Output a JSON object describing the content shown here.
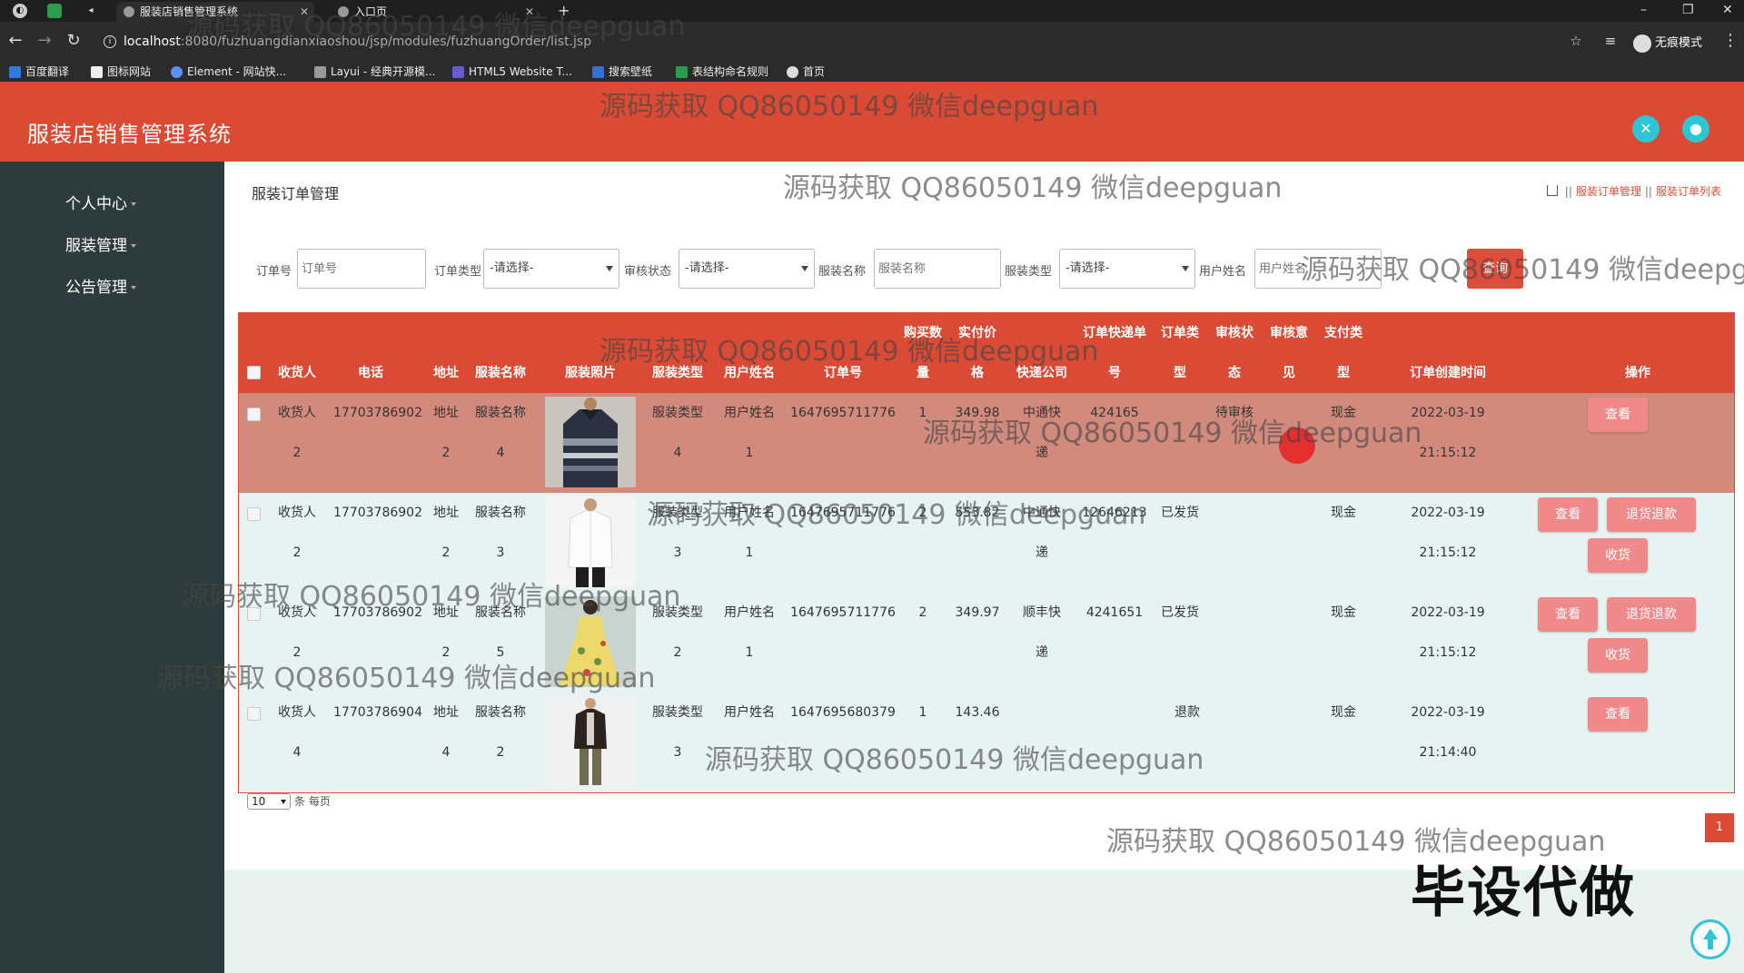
{
  "browser": {
    "tabs": [
      {
        "title": "服装店销售管理系统",
        "active": true
      },
      {
        "title": "入口页",
        "active": false
      }
    ],
    "url_host": "localhost",
    "url_path": ":8080/fuzhuangdianxiaoshou/jsp/modules/fuzhuangOrder/list.jsp",
    "incognito_label": "无痕模式",
    "bookmarks": [
      "百度翻译",
      "图标网站",
      "Element - 网站快...",
      "Layui - 经典开源模...",
      "HTML5 Website T...",
      "搜索壁纸",
      "表结构命名规则",
      "首页"
    ]
  },
  "app": {
    "title": "服装店销售管理系统"
  },
  "sidebar": {
    "items": [
      "个人中心",
      "服装管理",
      "公告管理"
    ]
  },
  "page": {
    "title": "服装订单管理",
    "breadcrumb": [
      "服装订单管理",
      "服装订单列表"
    ]
  },
  "search": {
    "order_no_label": "订单号",
    "order_no_placeholder": "订单号",
    "order_type_label": "订单类型",
    "order_type_value": "-请选择-",
    "audit_label": "审核状态",
    "audit_value": "-请选择-",
    "name_label": "服装名称",
    "name_placeholder": "服装名称",
    "cloth_type_label": "服装类型",
    "cloth_type_value": "-请选择-",
    "user_label": "用户姓名",
    "user_placeholder": "用户姓名",
    "button": "查询"
  },
  "table": {
    "headers": {
      "receiver": "收货人",
      "phone": "电话",
      "address": "地址",
      "cloth_name": "服装名称",
      "photo": "服装照片",
      "cloth_type": "服装类型",
      "user_name": "用户姓名",
      "order_no": "订单号",
      "qty_1": "购买数",
      "qty_2": "量",
      "price_1": "实付价",
      "price_2": "格",
      "express": "快递公司",
      "tracking_1": "订单快递单",
      "tracking_2": "号",
      "otype_1": "订单类",
      "otype_2": "型",
      "audit_1": "审核状",
      "audit_2": "态",
      "opinion_1": "审核意",
      "opinion_2": "见",
      "pay_1": "支付类",
      "pay_2": "型",
      "created": "订单创建时间",
      "ops": "操作"
    },
    "rows": [
      {
        "receiver": [
          "收货人",
          "2"
        ],
        "phone": "17703786902",
        "address": [
          "地址",
          "2"
        ],
        "cloth_name": [
          "服装名称",
          "4"
        ],
        "photo": "striped-polo",
        "cloth_type": [
          "服装类型",
          "4"
        ],
        "user_name": [
          "用户姓名",
          "1"
        ],
        "order_no": "1647695711776",
        "qty": "1",
        "price": "349.98",
        "express": [
          "中通快",
          "递"
        ],
        "tracking": "424165",
        "otype": "",
        "audit": "待审核",
        "opinion": "",
        "pay": "现金",
        "created": [
          "2022-03-19",
          "21:15:12"
        ],
        "buttons": [
          "查看"
        ]
      },
      {
        "receiver": [
          "收货人",
          "2"
        ],
        "phone": "17703786902",
        "address": [
          "地址",
          "2"
        ],
        "cloth_name": [
          "服装名称",
          "3"
        ],
        "photo": "white-shirt",
        "cloth_type": [
          "服装类型",
          "3"
        ],
        "user_name": [
          "用户姓名",
          "1"
        ],
        "order_no": "1647695711776",
        "qty": "2",
        "price": "553.82",
        "express": [
          "中通快",
          "递"
        ],
        "tracking": "12646213",
        "otype": "已发货",
        "audit": "",
        "opinion": "",
        "pay": "现金",
        "created": [
          "2022-03-19",
          "21:15:12"
        ],
        "buttons": [
          "查看",
          "退货退款",
          "收货"
        ]
      },
      {
        "receiver": [
          "收货人",
          "2"
        ],
        "phone": "17703786902",
        "address": [
          "地址",
          "2"
        ],
        "cloth_name": [
          "服装名称",
          "5"
        ],
        "photo": "yellow-dress",
        "cloth_type": [
          "服装类型",
          "2"
        ],
        "user_name": [
          "用户姓名",
          "1"
        ],
        "order_no": "1647695711776",
        "qty": "2",
        "price": "349.97",
        "express": [
          "顺丰快",
          "递"
        ],
        "tracking": "4241651",
        "otype": "已发货",
        "audit": "",
        "opinion": "",
        "pay": "现金",
        "created": [
          "2022-03-19",
          "21:15:12"
        ],
        "buttons": [
          "查看",
          "退货退款",
          "收货"
        ]
      },
      {
        "receiver": [
          "收货人",
          "4"
        ],
        "phone": "17703786904",
        "address": [
          "地址",
          "4"
        ],
        "cloth_name": [
          "服装名称",
          "2"
        ],
        "photo": "dark-jacket",
        "cloth_type": [
          "服装类型",
          "3"
        ],
        "user_name": [
          "用户姓名",
          ""
        ],
        "order_no": "1647695680379",
        "qty": "1",
        "price": "143.46",
        "express": [
          "",
          ""
        ],
        "tracking": "",
        "otype": "退款",
        "audit": "",
        "opinion": "",
        "pay": "现金",
        "created": [
          "2022-03-19",
          "21:14:40"
        ],
        "buttons": [
          "查看"
        ]
      }
    ]
  },
  "pager": {
    "size": "10",
    "size_suffix": "条 每页",
    "current": "1"
  },
  "watermark_text": "源码获取 QQ86050149 微信deepguan",
  "overlay_text": "毕设代做",
  "colors": {
    "brand": "#db4a34",
    "accent": "#2fc5d5",
    "button": "#f08a8a",
    "sidebar": "#2e3b3c"
  }
}
